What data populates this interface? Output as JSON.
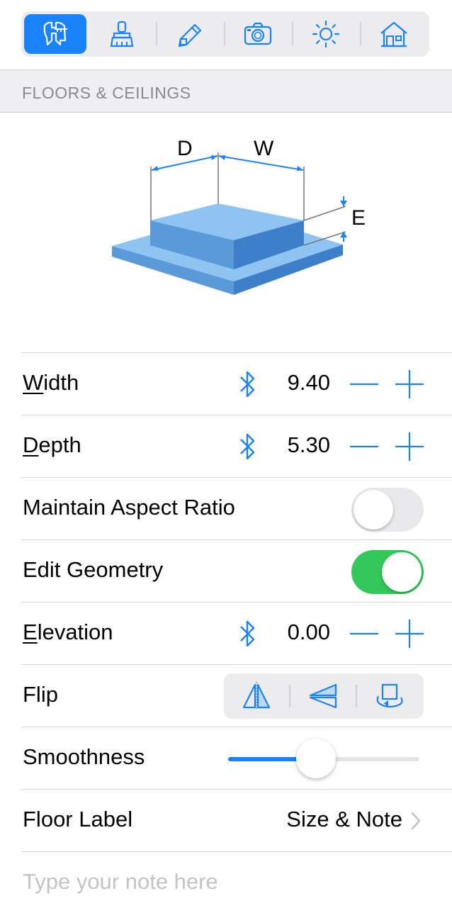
{
  "toolbar": {
    "tools": [
      {
        "icon": "ruler-caliper-icon",
        "active": true
      },
      {
        "icon": "paint-brush-icon",
        "active": false
      },
      {
        "icon": "pencil-icon",
        "active": false
      },
      {
        "icon": "camera-icon",
        "active": false
      },
      {
        "icon": "sun-icon",
        "active": false
      },
      {
        "icon": "house-icon",
        "active": false
      }
    ],
    "accent_color": "#1a82fb"
  },
  "section": {
    "title": "FLOORS & CEILINGS"
  },
  "diagram": {
    "label_d": "D",
    "label_w": "W",
    "label_e": "E"
  },
  "rows": {
    "width": {
      "label_mnemonic": "W",
      "label_rest": "idth",
      "value": "9.40"
    },
    "depth": {
      "label_mnemonic": "D",
      "label_rest": "epth",
      "value": "5.30"
    },
    "maintain_aspect": {
      "label": "Maintain Aspect Ratio",
      "on": false
    },
    "edit_geometry": {
      "label": "Edit Geometry",
      "on": true
    },
    "elevation": {
      "label_mnemonic": "E",
      "label_rest": "levation",
      "value": "0.00"
    },
    "flip": {
      "label": "Flip",
      "buttons": [
        "flip-horizontal-icon",
        "flip-vertical-icon",
        "rotate-icon"
      ]
    },
    "smoothness": {
      "label": "Smoothness",
      "value": 0.46
    },
    "floor_label": {
      "label": "Floor Label",
      "value": "Size & Note"
    }
  },
  "note": {
    "placeholder": "Type your note here"
  },
  "colors": {
    "toggle_on": "#34c759",
    "toggle_off": "#e9e9eb"
  }
}
